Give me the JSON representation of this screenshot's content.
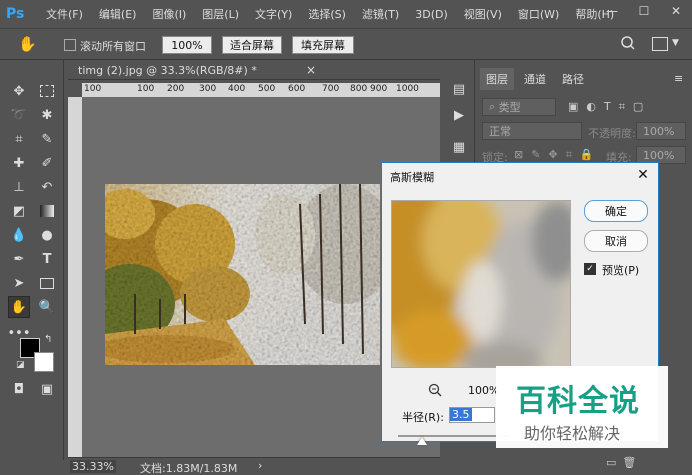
{
  "app": {
    "logo": "Ps"
  },
  "menu": [
    "文件(F)",
    "编辑(E)",
    "图像(I)",
    "图层(L)",
    "文字(Y)",
    "选择(S)",
    "滤镜(T)",
    "3D(D)",
    "视图(V)",
    "窗口(W)",
    "帮助(H)"
  ],
  "window_controls": {
    "minimize": "—",
    "maximize": "☐",
    "close": "✕"
  },
  "options": {
    "scroll_all_label": "滚动所有窗口",
    "zoom_100": "100%",
    "fit_screen": "适合屏幕",
    "fill_screen": "填充屏幕"
  },
  "document": {
    "tab_title": "timg (2).jpg @ 33.3%(RGB/8#) *",
    "tab_close": "×",
    "ruler_ticks": [
      "100",
      "100",
      "200",
      "300",
      "400",
      "500",
      "600",
      "700",
      "800",
      "900",
      "1000"
    ]
  },
  "status": {
    "zoom": "33.33%",
    "doc_info": "文档:1.83M/1.83M"
  },
  "layers_panel": {
    "tabs": [
      "图层",
      "通道",
      "路径"
    ],
    "filter_kind": "类型",
    "blend_mode": "正常",
    "opacity_label": "不透明度:",
    "opacity_value": "100%",
    "lock_label": "锁定:",
    "fill_label": "填充:",
    "fill_value": "100%"
  },
  "dialog": {
    "title": "高斯模糊",
    "ok": "确定",
    "cancel": "取消",
    "preview_label": "预览(P)",
    "preview_checked": true,
    "zoom_percent": "100%",
    "radius_label": "半径(R):",
    "radius_value": "3.5",
    "radius_fraction": 0.22
  },
  "watermark": {
    "title": "百科全说",
    "subtitle": "助你轻松解决"
  },
  "colors": {
    "accent": "#31a8ff",
    "dialog_border": "#1b7ec9",
    "watermark_green": "#16a085"
  }
}
